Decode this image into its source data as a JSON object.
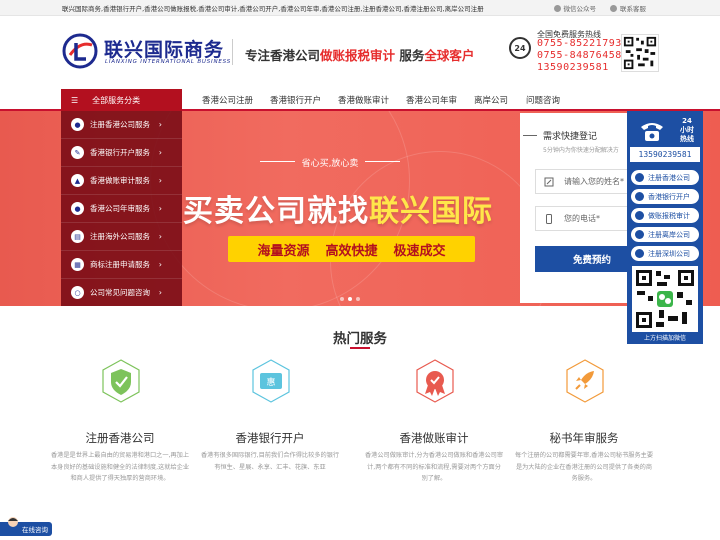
{
  "topbar": {
    "seo_text": "联兴国际商务,香港银行开户,香港公司做账报税,香港公司审计,香港公司开户,香港公司年审,香港公司注册,注册香港公司,香港注册公司,离岸公司注册",
    "wechat_label": "微信公众号",
    "contact_label": "联系客服"
  },
  "header": {
    "logo_cn": "联兴国际商务",
    "logo_en": "LIANXING INTERNATIONAL BUSINESS",
    "slogan_a": "专注香港公司",
    "slogan_b": "做账报税审计",
    "slogan_c": "服务",
    "slogan_d": "全球客户",
    "hotline_badge": "24",
    "hotline_title": "全国免费服务热线",
    "hotline_numbers": [
      "0755-85221793",
      "0755-84876458",
      "13590239581"
    ]
  },
  "nav": {
    "all_label": "全部服务分类",
    "items": [
      "香港公司注册",
      "香港银行开户",
      "香港做账审计",
      "香港公司年审",
      "离岸公司",
      "问题咨询"
    ]
  },
  "side_menu": {
    "items": [
      "注册香港公司服务",
      "香港银行开户服务",
      "香港做账审计服务",
      "香港公司年审服务",
      "注册海外公司服务",
      "商标注册申请服务",
      "公司常见问题咨询"
    ]
  },
  "banner": {
    "tag": "省心买,放心卖",
    "title_a": "买卖公司就找",
    "title_b": "联兴国际",
    "pill": [
      "海量资源",
      "高效快捷",
      "极速成交"
    ]
  },
  "form": {
    "title": "需求快捷登记",
    "subtitle": "5分钟内为你快速分配解决方",
    "name_placeholder": "请输入您的姓名*",
    "phone_placeholder": "您的电话*",
    "submit_label": "免费预约"
  },
  "float_panel": {
    "h24_a": "24",
    "h24_b": "小时",
    "h24_c": "热线",
    "phone": "13590239581",
    "buttons": [
      "注册香港公司",
      "香港银行开户",
      "做账报税审计",
      "注册离岸公司",
      "注册深圳公司"
    ],
    "qr_caption": "上方扫描加微信"
  },
  "services": {
    "title": "热门服务",
    "items": [
      {
        "name": "注册香港公司",
        "desc": "香港是是世界上最自由的贸易港和港口之一,再加上本身良好的基础设施和健全的法律制度,这就给企业和商人提供了得天独厚的营商环境。"
      },
      {
        "name": "香港银行开户",
        "desc": "香港有很多国际银行,目前我们合作得比较多的银行有恒生、星展、永享、汇丰、花旗、东亚"
      },
      {
        "name": "香港做账审计",
        "desc": "香港公司做账审计,分为香港公司做账和香港公司审计,两个都有不同的标准和流程,需要对两个方面分别了解。"
      },
      {
        "name": "秘书年审服务",
        "desc": "每个注册的公司都需要年审,香港公司秘书服务主要是为大陆的企业在香港注册的公司提供了各类的商务服务。"
      }
    ]
  },
  "chat": {
    "label": "在线咨询"
  },
  "colors": {
    "brand_red": "#c8102e",
    "brand_blue": "#1d4fa3",
    "banner_bg": "#ee5d51",
    "highlight_yellow": "#ffd200"
  }
}
